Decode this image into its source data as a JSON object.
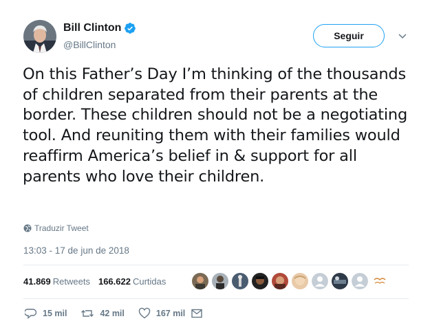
{
  "user": {
    "display_name": "Bill Clinton",
    "handle": "@BillClinton",
    "verified": true,
    "avatar_icon": "user-avatar"
  },
  "follow_button": {
    "label": "Seguir"
  },
  "tweet": {
    "text": "On this Father’s Day I’m thinking of the thousands of children separated from their parents at the border. These children should not be a negotiating tool. And reuniting them with their families would reaffirm America’s belief in & support for all parents who love their children."
  },
  "translate_link": {
    "label": "Traduzir Tweet"
  },
  "timestamp": "13:03 - 17 de jun de 2018",
  "stats": {
    "retweets_count": "41.869",
    "retweets_label": "Retweets",
    "likes_count": "166.622",
    "likes_label": "Curtidas"
  },
  "actions": {
    "reply_count": "15 mil",
    "retweet_count": "42 mil",
    "like_count": "167 mil"
  },
  "colors": {
    "accent": "#1da1f2",
    "text": "#14171a",
    "muted": "#657786",
    "divider": "#e6ecf0"
  }
}
